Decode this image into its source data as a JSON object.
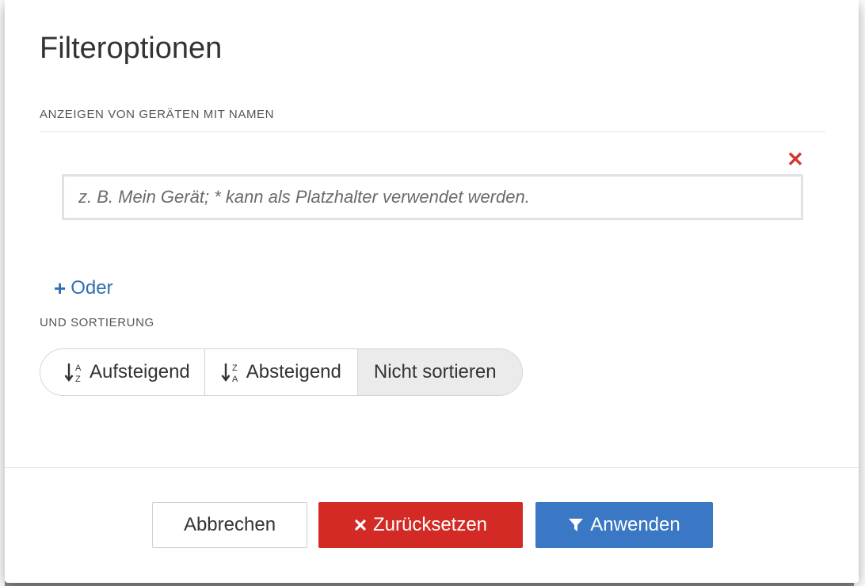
{
  "dialog": {
    "title": "Filteroptionen"
  },
  "name_filter": {
    "heading": "ANZEIGEN VON GERÄTEN MIT NAMEN",
    "input_value": "",
    "placeholder": "z. B. Mein Gerät; * kann als Platzhalter verwendet werden.",
    "remove_icon": "close-icon",
    "or_label": "Oder"
  },
  "sorting": {
    "heading": "UND SORTIERUNG",
    "options": [
      {
        "label": "Aufsteigend",
        "icon": "sort-alpha-asc-icon"
      },
      {
        "label": "Absteigend",
        "icon": "sort-alpha-desc-icon"
      },
      {
        "label": "Nicht sortieren",
        "icon": ""
      }
    ],
    "selected": "Nicht sortieren"
  },
  "footer": {
    "cancel_label": "Abbrechen",
    "reset_label": "Zurücksetzen",
    "apply_label": "Anwenden"
  },
  "colors": {
    "accent_blue": "#3a77c4",
    "danger_red": "#d32a25",
    "link_blue": "#2f6fb4"
  }
}
